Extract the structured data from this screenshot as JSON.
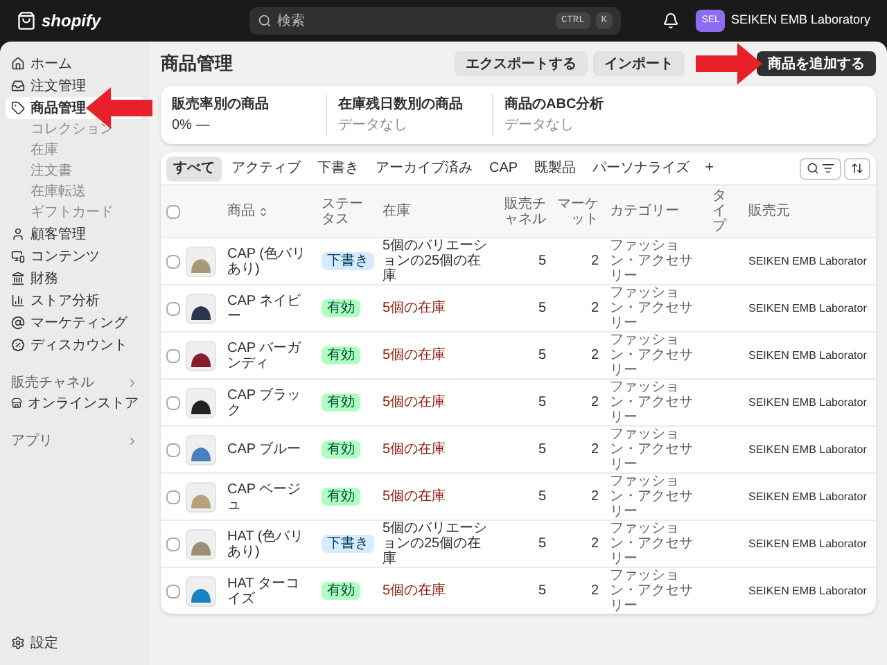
{
  "topbar": {
    "logo": "shopify",
    "search": {
      "placeholder": "検索",
      "keys": [
        "CTRL",
        "K"
      ]
    },
    "account": {
      "initials": "SEL",
      "name": "SEIKEN EMB Laboratory"
    }
  },
  "sidebar": {
    "items": [
      {
        "label": "ホーム",
        "selected": false
      },
      {
        "label": "注文管理",
        "selected": false
      },
      {
        "label": "商品管理",
        "selected": true,
        "children": [
          {
            "label": "コレクション"
          },
          {
            "label": "在庫"
          },
          {
            "label": "注文書"
          },
          {
            "label": "在庫転送"
          },
          {
            "label": "ギフトカード"
          }
        ]
      },
      {
        "label": "顧客管理",
        "selected": false
      },
      {
        "label": "コンテンツ",
        "selected": false
      },
      {
        "label": "財務",
        "selected": false
      },
      {
        "label": "ストア分析",
        "selected": false
      },
      {
        "label": "マーケティング",
        "selected": false
      },
      {
        "label": "ディスカウント",
        "selected": false
      }
    ],
    "sections": [
      {
        "label": "販売チャネル",
        "items": [
          {
            "label": "オンラインストア"
          }
        ]
      },
      {
        "label": "アプリ"
      }
    ],
    "footer": "設定"
  },
  "page": {
    "title": "商品管理",
    "actions": [
      "エクスポートする",
      "インポート"
    ],
    "primary_action": "商品を追加する"
  },
  "stats": [
    {
      "label": "販売率別の商品",
      "value": "0%  —",
      "empty": false
    },
    {
      "label": "在庫残日数別の商品",
      "value": "データなし",
      "empty": true
    },
    {
      "label": "商品のABC分析",
      "value": "データなし",
      "empty": true
    }
  ],
  "tabs": [
    {
      "label": "すべて",
      "selected": true
    },
    {
      "label": "アクティブ",
      "selected": false
    },
    {
      "label": "下書き",
      "selected": false
    },
    {
      "label": "アーカイブ済み",
      "selected": false
    },
    {
      "label": "CAP",
      "selected": false
    },
    {
      "label": "既製品",
      "selected": false
    },
    {
      "label": "パーソナライズ",
      "selected": false
    }
  ],
  "add_tab": "+",
  "table": {
    "all_selected": false,
    "columns": [
      "商品",
      "ステータス",
      "在庫",
      "販売チャネル",
      "マーケット",
      "カテゴリー",
      "タイプ",
      "販売元"
    ],
    "rows": [
      {
        "selected": false,
        "color": "#a8997a",
        "name": "CAP (色バリあり)",
        "status": {
          "label": "下書き",
          "kind": "draft"
        },
        "inventory": "5個のバリエーションの25個の在庫",
        "low_stock": false,
        "channels": "5",
        "markets": "2",
        "category": "ファッション・アクセサリー",
        "vendor": "SEIKEN EMB Laborator"
      },
      {
        "selected": false,
        "color": "#2b3550",
        "name": "CAP ネイビー",
        "status": {
          "label": "有効",
          "kind": "active"
        },
        "inventory": "5個の在庫",
        "low_stock": true,
        "channels": "5",
        "markets": "2",
        "category": "ファッション・アクセサリー",
        "vendor": "SEIKEN EMB Laborator"
      },
      {
        "selected": false,
        "color": "#8a1b2b",
        "name": "CAP バーガンディ",
        "status": {
          "label": "有効",
          "kind": "active"
        },
        "inventory": "5個の在庫",
        "low_stock": true,
        "channels": "5",
        "markets": "2",
        "category": "ファッション・アクセサリー",
        "vendor": "SEIKEN EMB Laborator"
      },
      {
        "selected": false,
        "color": "#222222",
        "name": "CAP ブラック",
        "status": {
          "label": "有効",
          "kind": "active"
        },
        "inventory": "5個の在庫",
        "low_stock": true,
        "channels": "5",
        "markets": "2",
        "category": "ファッション・アクセサリー",
        "vendor": "SEIKEN EMB Laborator"
      },
      {
        "selected": false,
        "color": "#4a7fc0",
        "name": "CAP ブルー",
        "status": {
          "label": "有効",
          "kind": "active"
        },
        "inventory": "5個の在庫",
        "low_stock": true,
        "channels": "5",
        "markets": "2",
        "category": "ファッション・アクセサリー",
        "vendor": "SEIKEN EMB Laborator"
      },
      {
        "selected": false,
        "color": "#b7a27e",
        "name": "CAP ベージュ",
        "status": {
          "label": "有効",
          "kind": "active"
        },
        "inventory": "5個の在庫",
        "low_stock": true,
        "channels": "5",
        "markets": "2",
        "category": "ファッション・アクセサリー",
        "vendor": "SEIKEN EMB Laborator"
      },
      {
        "selected": false,
        "color": "#9c8e72",
        "name": "HAT (色バリあり)",
        "status": {
          "label": "下書き",
          "kind": "draft"
        },
        "inventory": "5個のバリエーションの25個の在庫",
        "low_stock": false,
        "channels": "5",
        "markets": "2",
        "category": "ファッション・アクセサリー",
        "vendor": "SEIKEN EMB Laborator"
      },
      {
        "selected": false,
        "color": "#1b7fc4",
        "name": "HAT ターコイズ",
        "status": {
          "label": "有効",
          "kind": "active"
        },
        "inventory": "5個の在庫",
        "low_stock": true,
        "channels": "5",
        "markets": "2",
        "category": "ファッション・アクセサリー",
        "vendor": "SEIKEN EMB Laborator"
      }
    ]
  }
}
